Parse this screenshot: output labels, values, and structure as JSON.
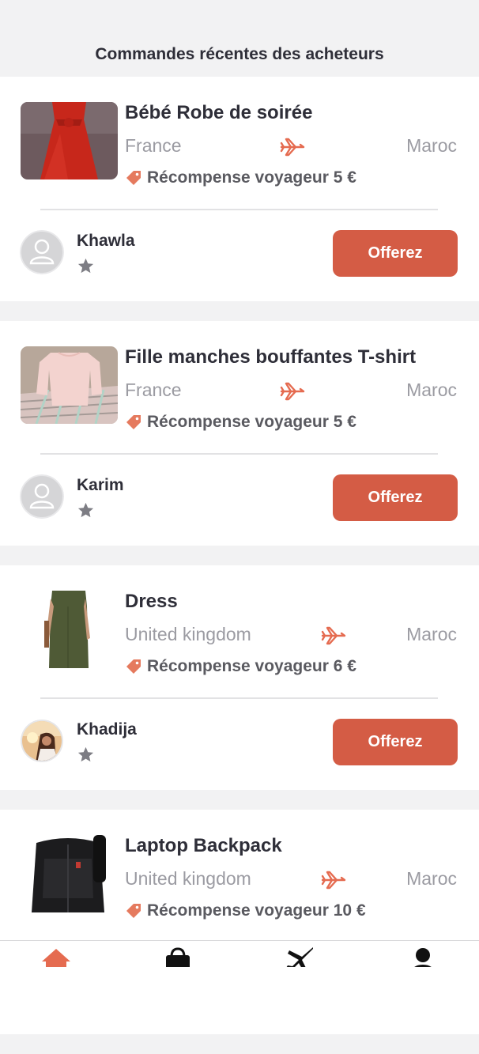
{
  "header": {
    "title": "Commandes récentes des acheteurs"
  },
  "colors": {
    "accent": "#d45c45",
    "background": "#f2f2f3",
    "muted": "#9b9ba2"
  },
  "orders": [
    {
      "title": "Bébé Robe de soirée",
      "from": "France",
      "to": "Maroc",
      "reward": "Récompense voyageur 5 €",
      "buyer": "Khawla",
      "button": "Offerez",
      "image": "red-dress-photo",
      "avatar": "default-avatar"
    },
    {
      "title": "Fille manches bouffantes T-shirt",
      "from": "France",
      "to": "Maroc",
      "reward": "Récompense voyageur 5 €",
      "buyer": "Karim",
      "button": "Offerez",
      "image": "pink-shirt-photo",
      "avatar": "default-avatar"
    },
    {
      "title": "Dress",
      "from": "United kingdom",
      "to": "Maroc",
      "reward": "Récompense voyageur 6 €",
      "buyer": "Khadija",
      "button": "Offerez",
      "image": "green-dress-photo",
      "avatar": "profile-photo"
    },
    {
      "title": "Laptop Backpack",
      "from": "United kingdom",
      "to": "Maroc",
      "reward": "Récompense voyageur 10 €",
      "image": "black-backpack-photo"
    }
  ],
  "nav": [
    {
      "icon": "home-icon",
      "active": true
    },
    {
      "icon": "shopping-bag-icon",
      "active": false
    },
    {
      "icon": "airplane-icon",
      "active": false
    },
    {
      "icon": "profile-icon",
      "active": false
    }
  ]
}
